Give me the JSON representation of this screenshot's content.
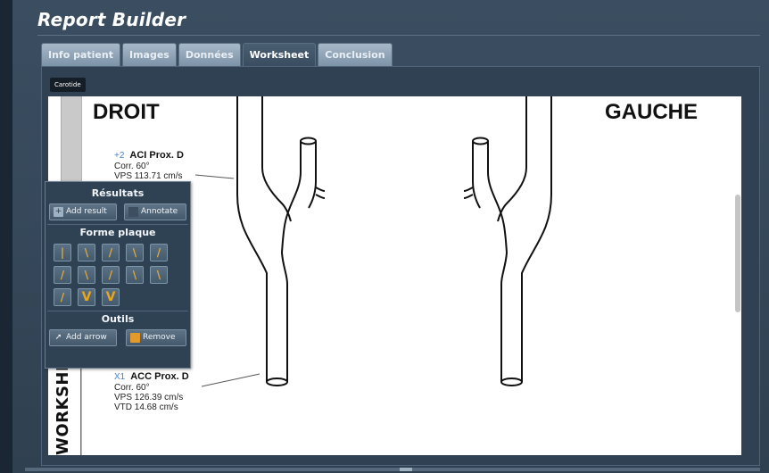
{
  "app": {
    "title": "Report Builder"
  },
  "tabs": [
    {
      "label": "Info patient",
      "active": false
    },
    {
      "label": "Images",
      "active": false
    },
    {
      "label": "Données",
      "active": false
    },
    {
      "label": "Worksheet",
      "active": true
    },
    {
      "label": "Conclusion",
      "active": false
    }
  ],
  "subtab": {
    "label": "Carotide"
  },
  "worksheet": {
    "vertical_label": "WORKSHEET",
    "right_heading": "DROIT",
    "left_heading": "GAUCHE",
    "measurements": [
      {
        "marker": "+2",
        "site": "ACI Prox. D",
        "lines": [
          "Corr. 60°",
          "VPS 113.71 cm/s"
        ]
      },
      {
        "marker": "X1",
        "site": "ACC Prox. D",
        "lines": [
          "Corr. 60°",
          "VPS 126.39 cm/s",
          "VTD 14.68 cm/s"
        ]
      }
    ]
  },
  "panel": {
    "results_title": "Résultats",
    "add_result_label": "Add result",
    "annotate_label": "Annotate",
    "plaque_title": "Forme plaque",
    "plaque_glyphs": [
      "|",
      "\\",
      "/",
      "\\",
      "/",
      "/",
      "\\",
      "/",
      "\\",
      "\\",
      "/",
      "V",
      "V"
    ],
    "tools_title": "Outils",
    "add_arrow_label": "Add arrow",
    "remove_label": "Remove"
  },
  "colors": {
    "accent": "#e9a51c",
    "marker": "#4a7fd0",
    "panel_bg": "#2f4253"
  }
}
